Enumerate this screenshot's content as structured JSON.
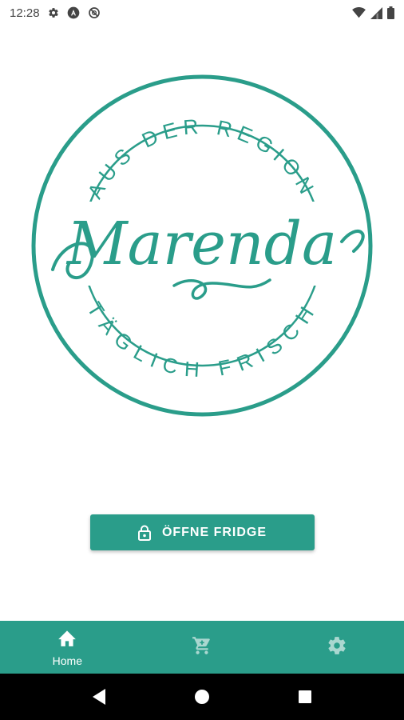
{
  "status_bar": {
    "time": "12:28",
    "left_icons": [
      "settings-gear-icon",
      "android-a-icon",
      "no-sync-icon"
    ],
    "right_icons": [
      "wifi-icon",
      "cell-signal-icon",
      "battery-icon"
    ]
  },
  "logo": {
    "top_text": "AUS DER REGION",
    "brand": "Marenda",
    "bottom_text": "TÄGLICH FRISCH",
    "color": "#2a9d8a"
  },
  "main": {
    "open_button_label": "ÖFFNE FRIDGE",
    "open_button_icon": "lock-icon"
  },
  "bottom_nav": {
    "background": "#2a9d8a",
    "items": [
      {
        "label": "Home",
        "icon": "home-icon",
        "active": true
      },
      {
        "label": "",
        "icon": "cart-icon",
        "active": false
      },
      {
        "label": "",
        "icon": "settings-icon",
        "active": false
      }
    ]
  },
  "system_nav": {
    "buttons": [
      "back-icon",
      "home-circle-icon",
      "recents-icon"
    ]
  }
}
